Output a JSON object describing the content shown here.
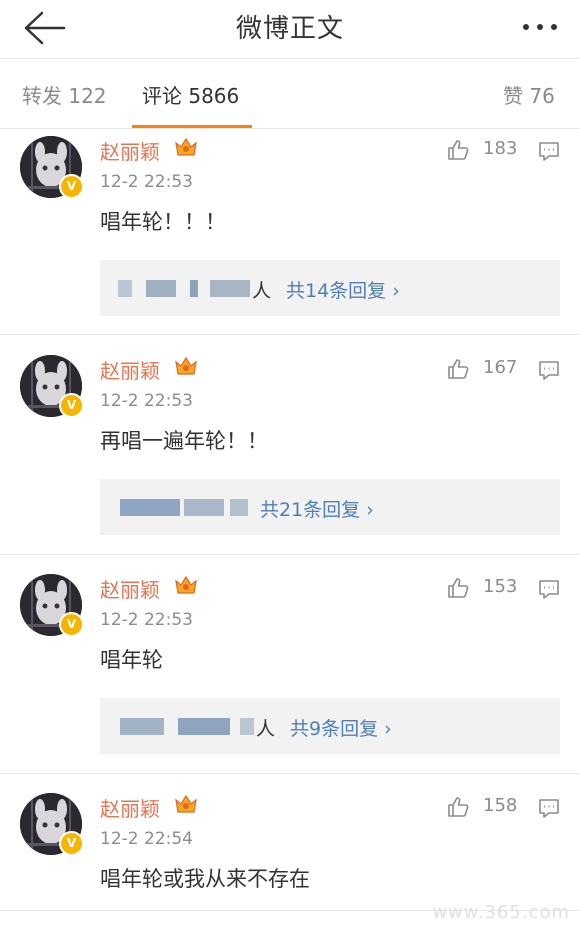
{
  "header": {
    "title": "微博正文",
    "back_icon": "arrow-left-icon",
    "more_icon": "more-dots-icon"
  },
  "tabs": [
    {
      "label": "转发 122"
    },
    {
      "label": "评论 5866",
      "active": true
    },
    {
      "label": "赞 76"
    }
  ],
  "comments": [
    {
      "user": "赵丽颖",
      "time": "12-2 22:53",
      "text": "唱年轮！！！",
      "likes": "183",
      "replies_label": "共14条回复 ›",
      "people_suffix": "人"
    },
    {
      "user": "赵丽颖",
      "time": "12-2 22:53",
      "text": "再唱一遍年轮！！",
      "likes": "167",
      "replies_label": "共21条回复 ›"
    },
    {
      "user": "赵丽颖",
      "time": "12-2 22:53",
      "text": "唱年轮",
      "likes": "153",
      "replies_label": "共9条回复 ›",
      "people_suffix": "人"
    },
    {
      "user": "赵丽颖",
      "time": "12-2 22:54",
      "text": "唱年轮或我从来不存在",
      "likes": "158"
    }
  ],
  "watermark": "www.365.com",
  "colors": {
    "accent": "#ff8200",
    "username": "#eb7350",
    "link": "#4f7fb5",
    "badge": "#f7b500"
  }
}
